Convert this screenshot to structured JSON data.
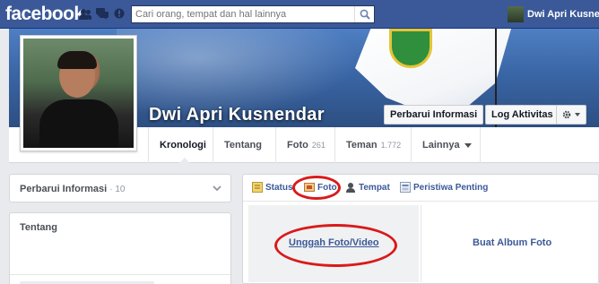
{
  "topbar": {
    "logo": "facebook",
    "search_placeholder": "Cari orang, tempat dan hal lainnya",
    "user_name": "Dwi Apri Kusnendar",
    "icons": [
      "friend-requests-icon",
      "messages-icon",
      "notifications-icon",
      "search-icon"
    ]
  },
  "profile": {
    "name": "Dwi Apri Kusnendar",
    "update_info_button": "Perbarui Informasi",
    "activity_log_button": "Log Aktivitas",
    "settings_icon": "gear-icon"
  },
  "tabs": [
    {
      "label": "Kronologi",
      "count": ""
    },
    {
      "label": "Tentang",
      "count": ""
    },
    {
      "label": "Foto",
      "count": "261"
    },
    {
      "label": "Teman",
      "count": "1.772"
    },
    {
      "label": "Lainnya",
      "count": ""
    }
  ],
  "left": {
    "update_info": {
      "label": "Perbarui Informasi",
      "count": "· 10"
    },
    "about": {
      "label": "Tentang"
    }
  },
  "composer": {
    "tabs": [
      {
        "label": "Status",
        "icon": "status-icon"
      },
      {
        "label": "Foto",
        "icon": "photo-icon"
      },
      {
        "label": "Tempat",
        "icon": "place-icon"
      },
      {
        "label": "Peristiwa Penting",
        "icon": "life-event-icon"
      }
    ],
    "upload_label": "Unggah Foto/Video",
    "album_label": "Buat Album Foto"
  },
  "colors": {
    "brand": "#3b5998",
    "annotation": "#d91a1a",
    "page_bg": "#e9eaed"
  }
}
